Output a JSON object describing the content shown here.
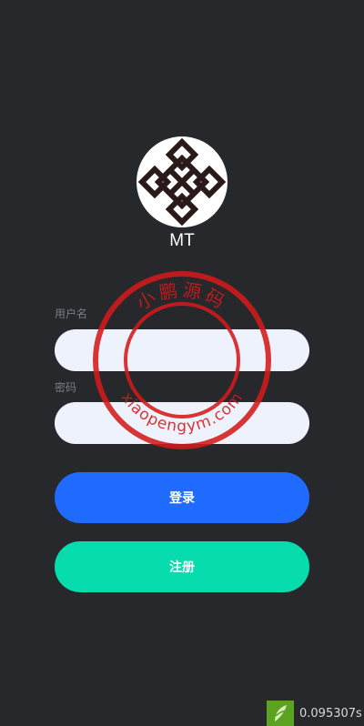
{
  "app": {
    "name": "MT"
  },
  "form": {
    "username_label": "用户名",
    "username_value": "",
    "password_label": "密码",
    "password_value": ""
  },
  "buttons": {
    "login_label": "登录",
    "register_label": "注册"
  },
  "watermark": {
    "top_text": "小鹏源码",
    "bottom_text": "xiaopengym.com",
    "color": "#d31a1a"
  },
  "timer": {
    "value": "0.095307s",
    "icon": "leaf-icon"
  },
  "colors": {
    "background": "#26282c",
    "login": "#1f6bff",
    "register": "#06dcae",
    "field": "#eef2fd"
  }
}
